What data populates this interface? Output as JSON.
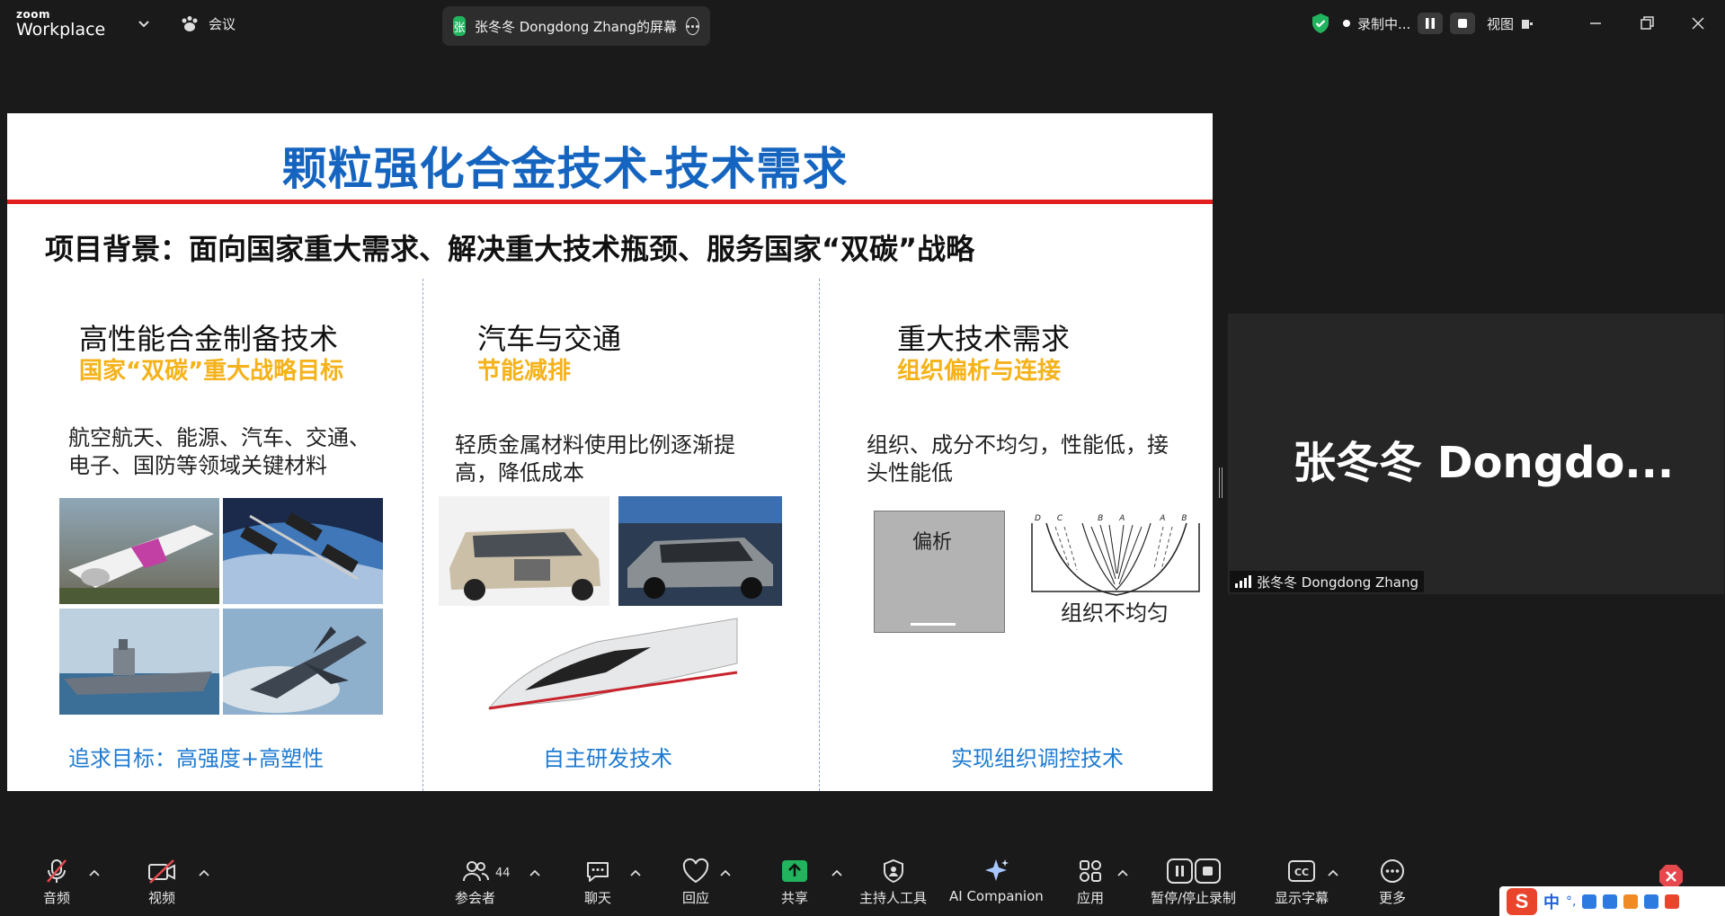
{
  "topbar": {
    "logo_small": "zoom",
    "logo_big": "Workplace",
    "meeting_label": "会议",
    "share_avatar": "张",
    "share_text": "张冬冬  Dongdong Zhang的屏幕",
    "recording_label": "录制中...",
    "view_label": "视图"
  },
  "slide": {
    "title": "颗粒强化合金技术-技术需求",
    "background_line": "项目背景：面向国家重大需求、解决重大技术瓶颈、服务国家“双碳”战略",
    "columns": [
      {
        "heading": "高性能合金制备技术",
        "subheading": "国家“双碳”重大战略目标",
        "desc_line1": "航空航天、能源、汽车、交通、",
        "desc_line2": "电子、国防等领域关键材料",
        "goal": "追求目标：高强度+高塑性"
      },
      {
        "heading": "汽车与交通",
        "subheading": "节能减排",
        "desc_line1": "轻质金属材料使用比例逐渐提",
        "desc_line2": "高，降低成本",
        "goal": "自主研发技术"
      },
      {
        "heading": "重大技术需求",
        "subheading": "组织偏析与连接",
        "desc_line1": "组织、成分不均匀，性能低，接",
        "desc_line2": "头性能低",
        "goal": "实现组织调控技术",
        "image_label_segregation": "偏析",
        "image_label_uneven": "组织不均匀",
        "diagram_marks": "DC  BA  AB  CD"
      }
    ]
  },
  "participant": {
    "tile_name": "张冬冬  Dongdo...",
    "label": "张冬冬  Dongdong Zhang"
  },
  "toolbar": {
    "audio": "音频",
    "video": "视频",
    "participants": "参会者",
    "participants_count": "44",
    "chat": "聊天",
    "reactions": "回应",
    "share": "共享",
    "host_tools": "主持人工具",
    "ai_companion": "AI Companion",
    "apps": "应用",
    "record": "暂停/停止录制",
    "captions": "显示字幕",
    "more": "更多"
  },
  "ime": {
    "lang": "中"
  },
  "colors": {
    "title_blue": "#1565c0",
    "accent_red": "#e01e1e",
    "sub_gold": "#f5b21a",
    "goal_blue": "#1f7bd1",
    "share_green": "#22b35e"
  }
}
